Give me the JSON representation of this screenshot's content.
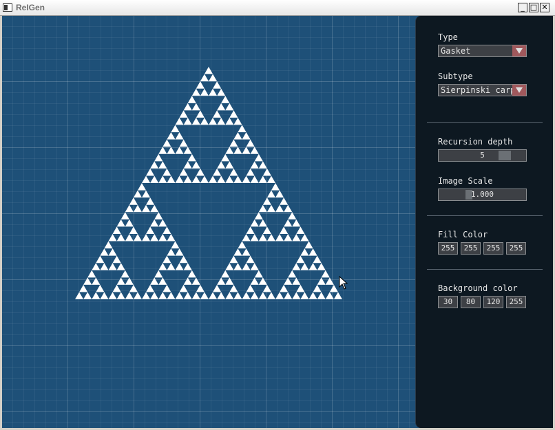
{
  "window": {
    "title": "ReIGen",
    "minimize_glyph": "_",
    "maximize_glyph": "□",
    "close_glyph": "✕"
  },
  "canvas": {
    "background_rgba": [
      30,
      80,
      120,
      255
    ],
    "fill_rgba": [
      255,
      255,
      255,
      255
    ],
    "recursion_depth": 5,
    "image_scale": 1.0
  },
  "panel": {
    "type_label": "Type",
    "type_value": "Gasket",
    "subtype_label": "Subtype",
    "subtype_value": "Sierpinski carpet",
    "recursion_label": "Recursion depth",
    "recursion_value": "5",
    "recursion_fraction": 0.8,
    "scale_label": "Image Scale",
    "scale_value": "1.000",
    "scale_fraction": 0.33,
    "fill_label": "Fill Color",
    "fill": [
      "255",
      "255",
      "255",
      "255"
    ],
    "bg_label": "Background color",
    "bg": [
      "30",
      "80",
      "120",
      "255"
    ]
  },
  "colors": {
    "panel_bg": "#0d1821",
    "combo_arrow": "#a0585c",
    "canvas_bg": "#1e5078"
  }
}
